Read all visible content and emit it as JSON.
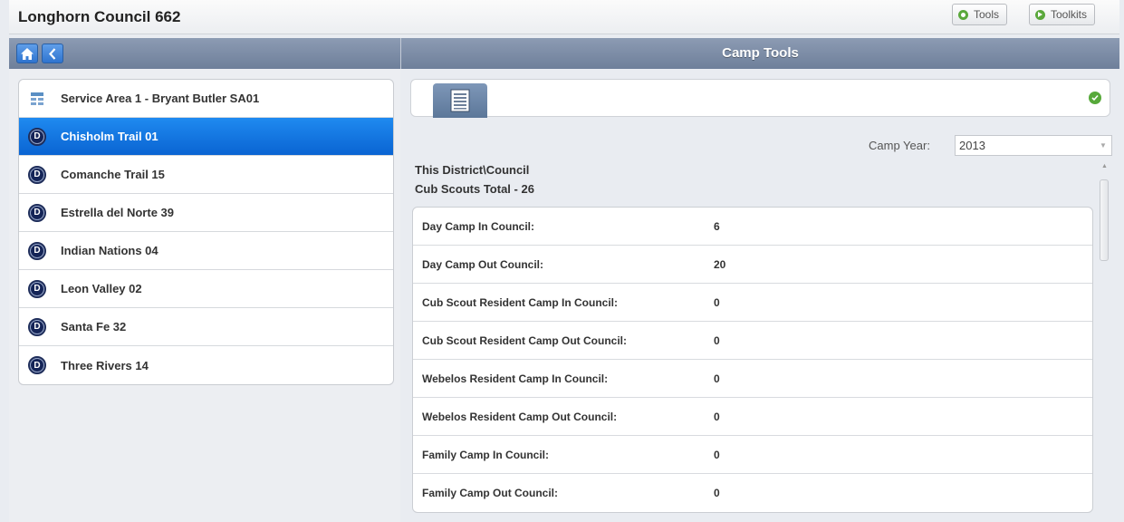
{
  "header": {
    "title": "Longhorn Council 662",
    "tools_label": "Tools",
    "toolkits_label": "Toolkits"
  },
  "nav": {
    "section_title": "Camp Tools",
    "home_icon": "home-icon",
    "back_icon": "back-icon"
  },
  "sidebar": {
    "items": [
      {
        "label": "Service Area 1 - Bryant Butler SA01",
        "icon": "service-area-icon",
        "selected": false
      },
      {
        "label": "Chisholm Trail 01",
        "icon": "district-icon",
        "selected": true
      },
      {
        "label": "Comanche Trail 15",
        "icon": "district-icon",
        "selected": false
      },
      {
        "label": "Estrella del Norte 39",
        "icon": "district-icon",
        "selected": false
      },
      {
        "label": "Indian Nations 04",
        "icon": "district-icon",
        "selected": false
      },
      {
        "label": "Leon Valley 02",
        "icon": "district-icon",
        "selected": false
      },
      {
        "label": "Santa Fe 32",
        "icon": "district-icon",
        "selected": false
      },
      {
        "label": "Three Rivers 14",
        "icon": "district-icon",
        "selected": false
      }
    ],
    "district_badge": "D"
  },
  "main": {
    "camp_year_label": "Camp Year:",
    "camp_year_value": "2013",
    "heading_line1": "This District\\Council",
    "heading_line2": "Cub Scouts Total - 26",
    "rows": [
      {
        "label": "Day Camp In Council:",
        "value": "6"
      },
      {
        "label": "Day Camp Out Council:",
        "value": "20"
      },
      {
        "label": "Cub Scout Resident Camp In Council:",
        "value": "0"
      },
      {
        "label": "Cub Scout Resident Camp Out Council:",
        "value": "0"
      },
      {
        "label": "Webelos Resident Camp In Council:",
        "value": "0"
      },
      {
        "label": "Webelos Resident Camp Out Council:",
        "value": "0"
      },
      {
        "label": "Family Camp In Council:",
        "value": "0"
      },
      {
        "label": "Family Camp Out Council:",
        "value": "0"
      }
    ]
  },
  "colors": {
    "selected_item": "#0a64d2",
    "header_band": "#7a8aa5",
    "status_green": "#57a93a"
  }
}
